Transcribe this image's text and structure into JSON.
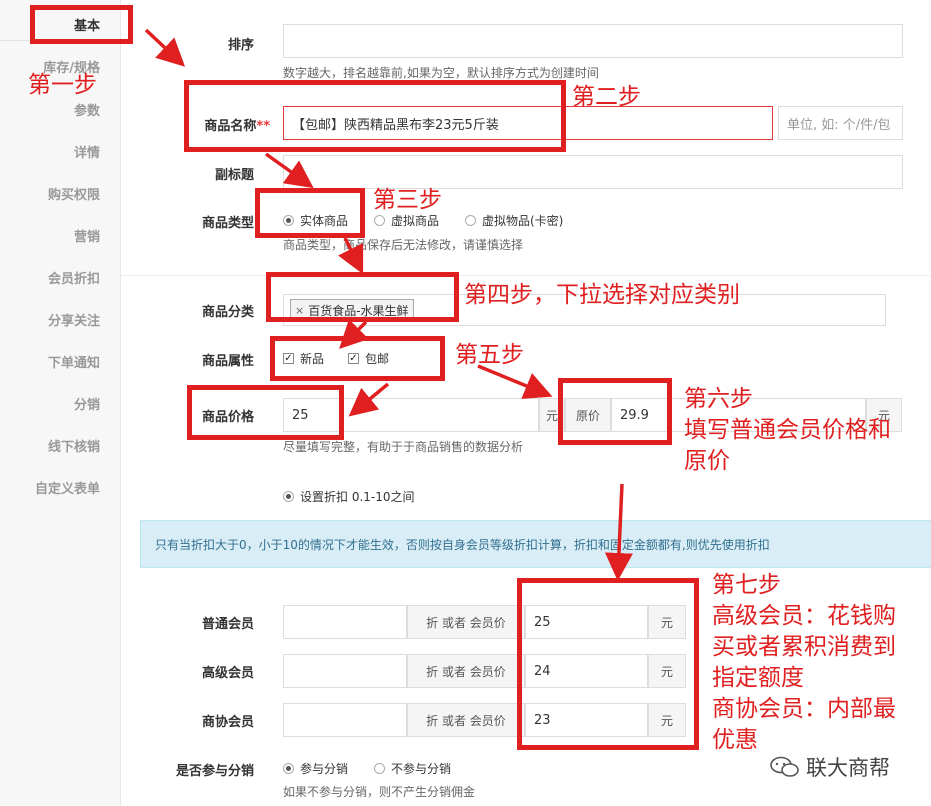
{
  "sidebar": {
    "items": [
      "基本",
      "库存/规格",
      "参数",
      "详情",
      "购买权限",
      "营销",
      "会员折扣",
      "分享关注",
      "下单通知",
      "分销",
      "线下核销",
      "自定义表单"
    ]
  },
  "form": {
    "sort_label": "排序",
    "sort_hint": "数字越大，排名越靠前,如果为空，默认排序方式为创建时间",
    "name_label": "商品名称",
    "required_mark": "**",
    "name_value": "【包邮】陕西精品黑布李23元5斤装",
    "unit_placeholder": "单位, 如: 个/件/包",
    "subtitle_label": "副标题",
    "type_label": "商品类型",
    "type_options": [
      "实体商品",
      "虚拟商品",
      "虚拟物品(卡密)"
    ],
    "type_hint": "商品类型，商品保存后无法修改，请谨慎选择",
    "category_label": "商品分类",
    "category_tag": "百货食品-水果生鲜",
    "category_tag_remove": "×",
    "attr_label": "商品属性",
    "attr_options": [
      "新品",
      "包邮"
    ],
    "price_label": "商品价格",
    "price_value": "25",
    "price_unit": "元",
    "original_label": "原价",
    "original_value": "29.9",
    "original_unit": "元",
    "price_hint": "尽量填写完整，有助于于商品销售的数据分析",
    "discount_option": "设置折扣 0.1-10之间",
    "discount_banner": "只有当折扣大于0，小于10的情况下才能生效，否则按自身会员等级折扣计算，折扣和固定金额都有,则优先使用折扣",
    "member_rows": [
      {
        "label": "普通会员",
        "addon": "折 或者 会员价",
        "value": "25",
        "unit": "元"
      },
      {
        "label": "高级会员",
        "addon": "折 或者 会员价",
        "value": "24",
        "unit": "元"
      },
      {
        "label": "商协会员",
        "addon": "折 或者 会员价",
        "value": "23",
        "unit": "元"
      }
    ],
    "distribution_label": "是否参与分销",
    "distribution_options": [
      "参与分销",
      "不参与分销"
    ],
    "distribution_hint": "如果不参与分销，则不产生分销佣金"
  },
  "annotations": {
    "step1": "第一步",
    "step2": "第二步",
    "step3": "第三步",
    "step4": "第四步，下拉选择对应类别",
    "step5": "第五步",
    "step6_lines": [
      "第六步",
      "填写普通会员价格和",
      "原价"
    ],
    "step7_lines": [
      "第七步",
      "高级会员：花钱购",
      "买或者累积消费到",
      "指定额度",
      "商协会员：内部最",
      "优惠"
    ]
  },
  "watermark": "联大商帮",
  "colors": {
    "annotation": "#e02020",
    "banner_bg": "#d9edf7",
    "banner_text": "#31708f"
  }
}
